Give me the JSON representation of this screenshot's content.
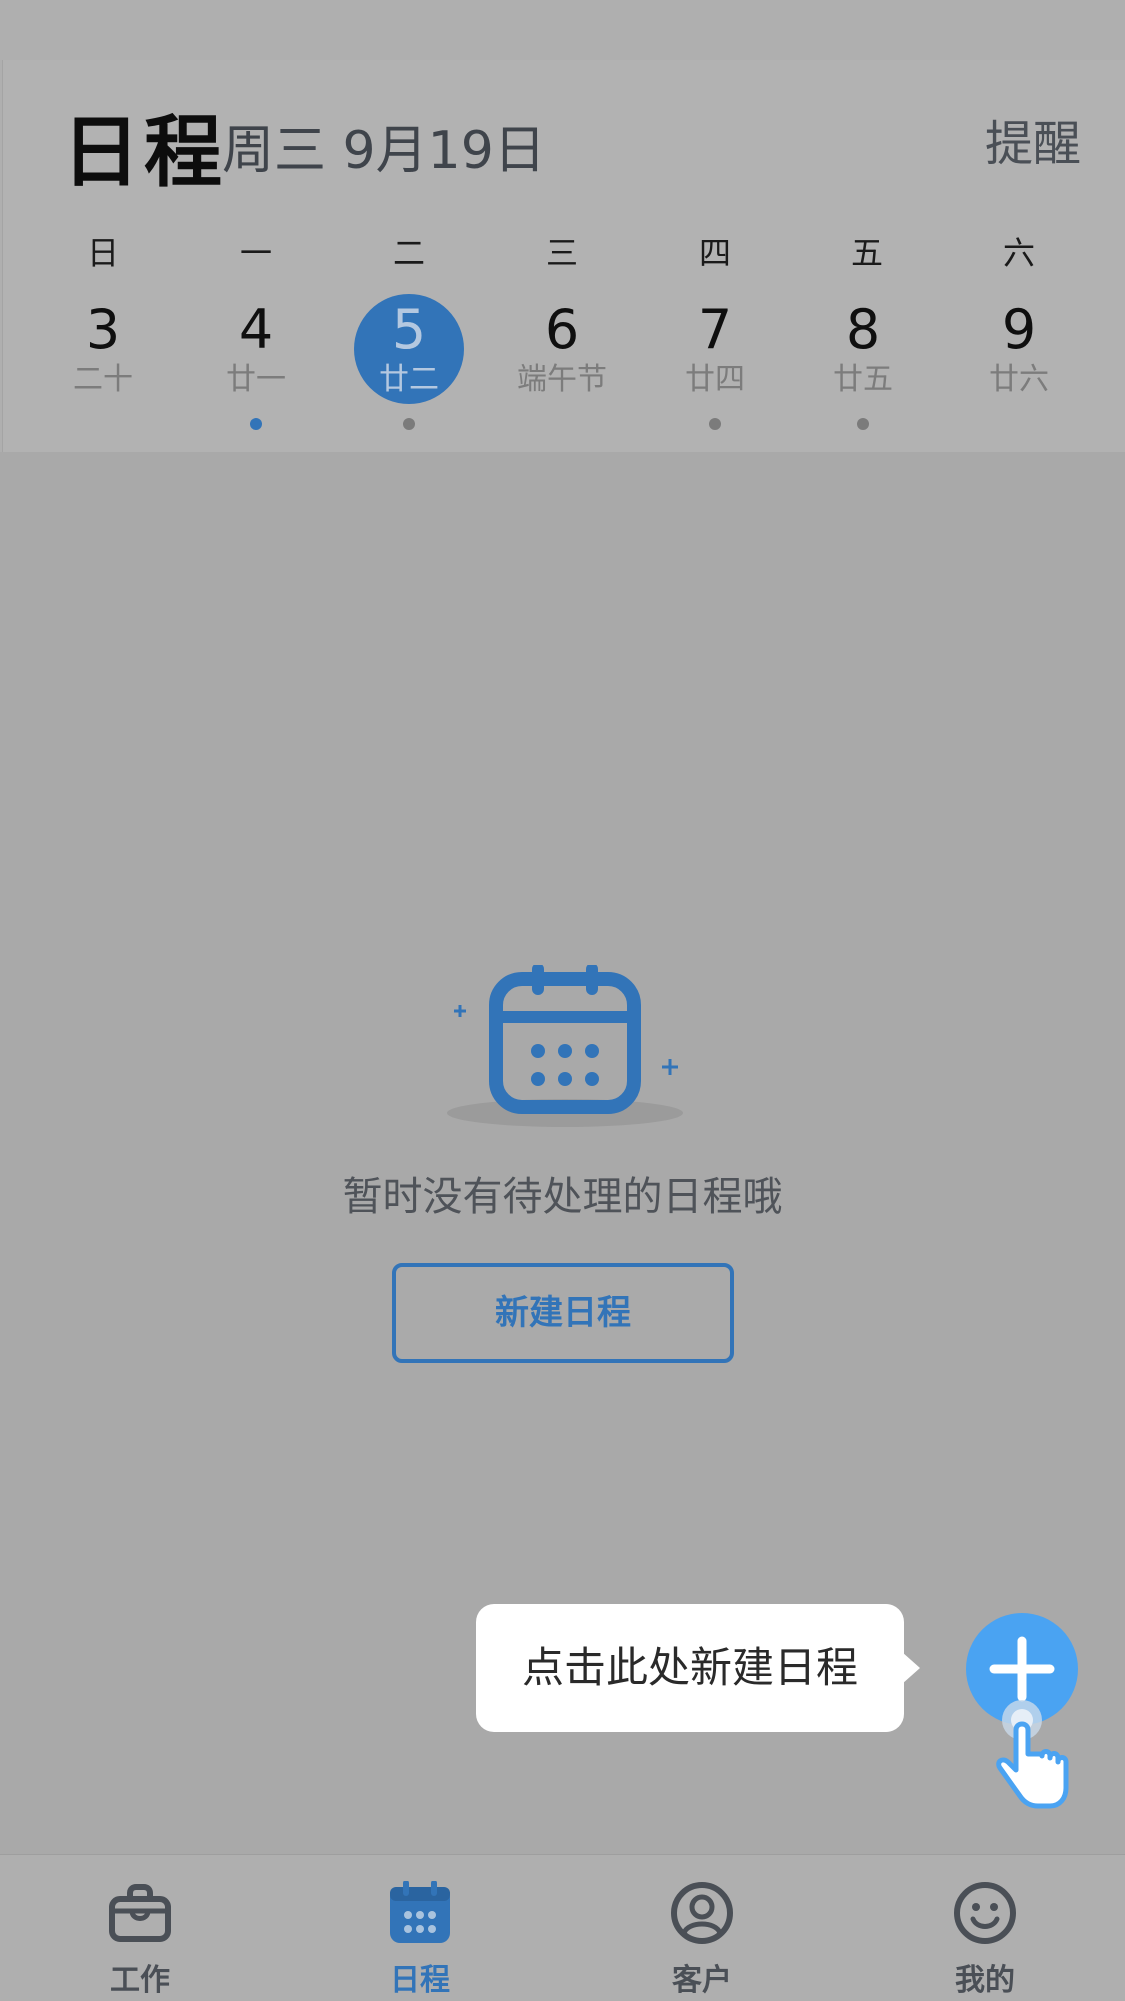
{
  "header": {
    "title": "日程",
    "date_label": "周三 9月19日",
    "remind_label": "提醒"
  },
  "calendar": {
    "weekdays": [
      "日",
      "一",
      "二",
      "三",
      "四",
      "五",
      "六"
    ],
    "days": [
      {
        "num": "3",
        "lunar": "二十",
        "dot": "none"
      },
      {
        "num": "4",
        "lunar": "廿一",
        "dot": "blue"
      },
      {
        "num": "5",
        "lunar": "廿二",
        "dot": "gray",
        "selected": true
      },
      {
        "num": "6",
        "lunar": "端午节",
        "dot": "none"
      },
      {
        "num": "7",
        "lunar": "廿四",
        "dot": "gray"
      },
      {
        "num": "8",
        "lunar": "廿五",
        "dot": "gray"
      },
      {
        "num": "9",
        "lunar": "廿六",
        "dot": "none"
      }
    ]
  },
  "empty_state": {
    "icon": "calendar-icon",
    "message": "暂时没有待处理的日程哦",
    "button_label": "新建日程"
  },
  "tooltip": {
    "text": "点击此处新建日程"
  },
  "fab": {
    "icon": "plus-icon"
  },
  "bottom_nav": {
    "items": [
      {
        "label": "工作",
        "icon": "briefcase-icon"
      },
      {
        "label": "日程",
        "icon": "calendar-icon",
        "active": true
      },
      {
        "label": "客户",
        "icon": "customer-icon"
      },
      {
        "label": "我的",
        "icon": "smiley-icon"
      }
    ]
  },
  "colors": {
    "accent": "#3274b8",
    "fab": "#4aa3f2",
    "overlay_bg": "#a9a9a9"
  }
}
